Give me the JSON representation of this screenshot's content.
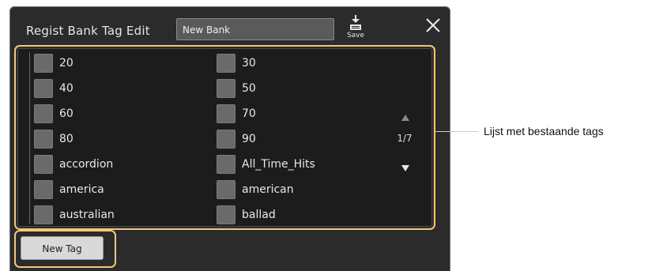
{
  "dialog": {
    "title": "Regist Bank Tag Edit",
    "bank_name": "New Bank",
    "save_label": "Save",
    "close_icon": "close-icon",
    "save_icon": "save-download-icon"
  },
  "tags": {
    "left": [
      "20",
      "40",
      "60",
      "80",
      "accordion",
      "america",
      "australian"
    ],
    "right": [
      "30",
      "50",
      "70",
      "90",
      "All_Time_Hits",
      "american",
      "ballad"
    ],
    "checked": false
  },
  "pagination": {
    "page_label": "1/7",
    "up_icon": "triangle-up-icon",
    "down_icon": "triangle-down-icon"
  },
  "new_tag_label": "New Tag",
  "annotation": {
    "callout_text": "Lijst met bestaande tags"
  },
  "colors": {
    "panel_bg": "#2b2b2b",
    "list_bg": "#1c1c1c",
    "highlight": "#f2c879",
    "checkbox": "#6a6a6a"
  }
}
